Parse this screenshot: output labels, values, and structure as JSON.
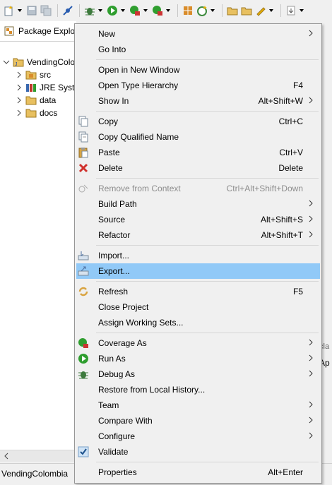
{
  "view": {
    "tab_title": "Package Explorer",
    "tree": [
      {
        "label": "VendingColombia",
        "icon": "project-icon",
        "indent": 0,
        "expanded": true
      },
      {
        "label": "src",
        "icon": "source-folder-icon",
        "indent": 1,
        "expanded": false
      },
      {
        "label": "JRE System Library",
        "icon": "library-icon",
        "indent": 1,
        "expanded": false
      },
      {
        "label": "data",
        "icon": "folder-icon",
        "indent": 1,
        "expanded": false
      },
      {
        "label": "docs",
        "icon": "folder-icon",
        "indent": 1,
        "expanded": false
      }
    ],
    "status": "VendingColombia",
    "right_fragment_1": "cla",
    "right_fragment_2": "Ap"
  },
  "menu": {
    "items": [
      {
        "label": "New",
        "accel": "",
        "submenu": true,
        "icon": ""
      },
      {
        "label": "Go Into",
        "accel": "",
        "submenu": false,
        "icon": ""
      },
      {
        "label": "Open in New Window",
        "accel": "",
        "submenu": false,
        "icon": ""
      },
      {
        "label": "Open Type Hierarchy",
        "accel": "F4",
        "submenu": false,
        "icon": ""
      },
      {
        "label": "Show In",
        "accel": "Alt+Shift+W",
        "submenu": true,
        "icon": ""
      },
      {
        "label": "Copy",
        "accel": "Ctrl+C",
        "submenu": false,
        "icon": "copy-icon"
      },
      {
        "label": "Copy Qualified Name",
        "accel": "",
        "submenu": false,
        "icon": "copy-qualified-name-icon"
      },
      {
        "label": "Paste",
        "accel": "Ctrl+V",
        "submenu": false,
        "icon": "paste-icon"
      },
      {
        "label": "Delete",
        "accel": "Delete",
        "submenu": false,
        "icon": "delete-icon"
      },
      {
        "label": "Remove from Context",
        "accel": "Ctrl+Alt+Shift+Down",
        "submenu": false,
        "icon": "remove-context-icon",
        "disabled": true
      },
      {
        "label": "Build Path",
        "accel": "",
        "submenu": true,
        "icon": ""
      },
      {
        "label": "Source",
        "accel": "Alt+Shift+S",
        "submenu": true,
        "icon": ""
      },
      {
        "label": "Refactor",
        "accel": "Alt+Shift+T",
        "submenu": true,
        "icon": ""
      },
      {
        "label": "Import...",
        "accel": "",
        "submenu": false,
        "icon": "import-icon"
      },
      {
        "label": "Export...",
        "accel": "",
        "submenu": false,
        "icon": "export-icon",
        "highlighted": true
      },
      {
        "label": "Refresh",
        "accel": "F5",
        "submenu": false,
        "icon": "refresh-icon"
      },
      {
        "label": "Close Project",
        "accel": "",
        "submenu": false,
        "icon": ""
      },
      {
        "label": "Assign Working Sets...",
        "accel": "",
        "submenu": false,
        "icon": ""
      },
      {
        "label": "Coverage As",
        "accel": "",
        "submenu": true,
        "icon": "coverage-icon"
      },
      {
        "label": "Run As",
        "accel": "",
        "submenu": true,
        "icon": "run-icon"
      },
      {
        "label": "Debug As",
        "accel": "",
        "submenu": true,
        "icon": "debug-icon"
      },
      {
        "label": "Restore from Local History...",
        "accel": "",
        "submenu": false,
        "icon": ""
      },
      {
        "label": "Team",
        "accel": "",
        "submenu": true,
        "icon": ""
      },
      {
        "label": "Compare With",
        "accel": "",
        "submenu": true,
        "icon": ""
      },
      {
        "label": "Configure",
        "accel": "",
        "submenu": true,
        "icon": ""
      },
      {
        "label": "Validate",
        "accel": "",
        "submenu": false,
        "icon": "validate-check-icon"
      },
      {
        "label": "Properties",
        "accel": "Alt+Enter",
        "submenu": false,
        "icon": ""
      }
    ]
  },
  "colors": {
    "highlight": "#91c9f7",
    "menu_bg": "#f0f0f0",
    "disabled_text": "#8d8d8d"
  }
}
